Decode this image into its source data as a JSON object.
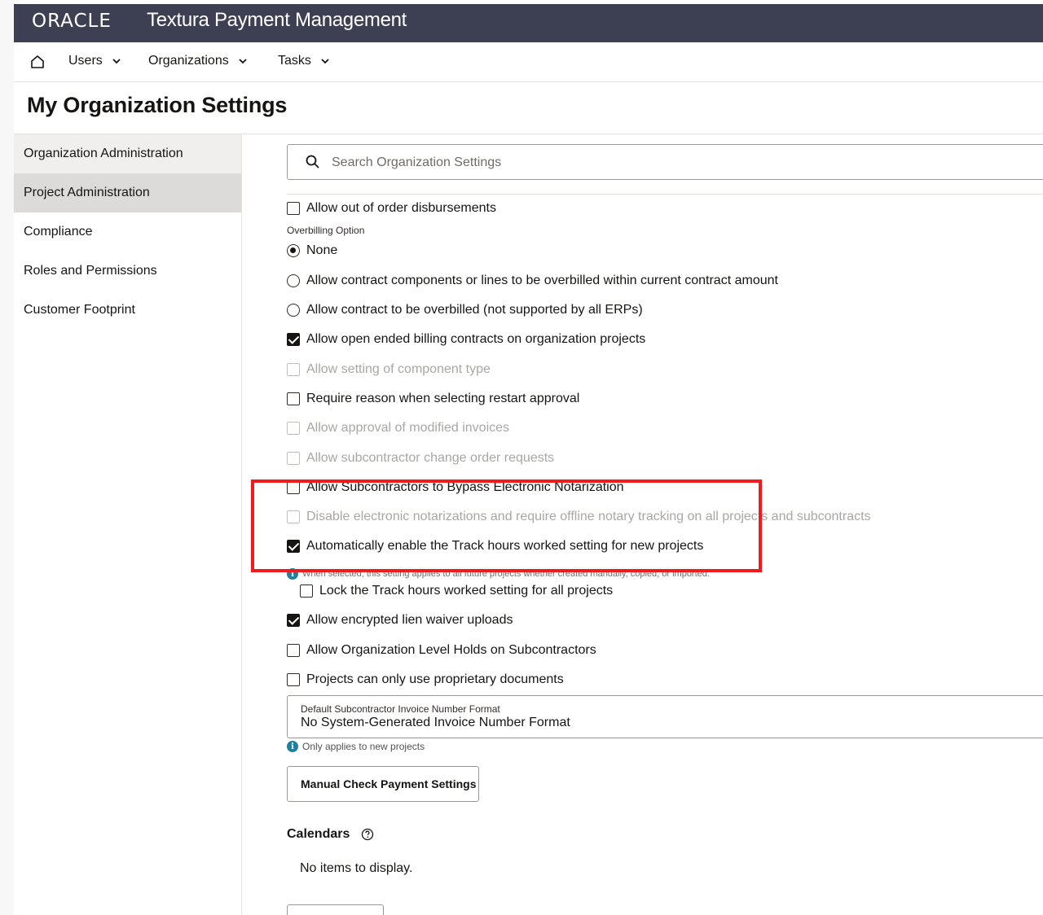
{
  "header": {
    "logo_text": "ORACLE",
    "product_title": "Textura Payment Management"
  },
  "nav": {
    "items": [
      {
        "label": "Users"
      },
      {
        "label": "Organizations"
      },
      {
        "label": "Tasks"
      }
    ]
  },
  "page": {
    "title": "My Organization Settings"
  },
  "sidebar": {
    "items": [
      {
        "label": "Organization Administration"
      },
      {
        "label": "Project Administration"
      },
      {
        "label": "Compliance"
      },
      {
        "label": "Roles and Permissions"
      },
      {
        "label": "Customer Footprint"
      }
    ]
  },
  "search": {
    "placeholder": "Search Organization Settings"
  },
  "settings": {
    "out_of_order": {
      "label": "Allow out of order disbursements",
      "checked": false
    },
    "overbilling_label": "Overbilling Option",
    "overbilling_options": [
      {
        "label": "None",
        "selected": true
      },
      {
        "label": "Allow contract components or lines to be overbilled within current contract amount",
        "selected": false
      },
      {
        "label": "Allow contract to be overbilled (not supported by all ERPs)",
        "selected": false
      }
    ],
    "open_ended": {
      "label": "Allow open ended billing contracts on organization projects",
      "checked": true
    },
    "component_type": {
      "label": "Allow setting of component type",
      "checked": false,
      "disabled": true
    },
    "restart_reason": {
      "label": "Require reason when selecting restart approval",
      "checked": false
    },
    "modified_invoices": {
      "label": "Allow approval of modified invoices",
      "checked": false,
      "disabled": true
    },
    "sub_change_orders": {
      "label": "Allow subcontractor change order requests",
      "checked": false,
      "disabled": true
    },
    "bypass_notarization": {
      "label": "Allow Subcontractors to Bypass Electronic Notarization",
      "checked": false
    },
    "disable_notarizations": {
      "label": "Disable electronic notarizations and require offline notary tracking on all projects and subcontracts",
      "checked": false,
      "disabled": true
    },
    "track_hours": {
      "label": "Automatically enable the Track hours worked setting for new projects",
      "checked": true
    },
    "track_hours_help": "When selected, this setting applies to all future projects whether created manually, copied, or imported.",
    "lock_track_hours": {
      "label": "Lock the Track hours worked setting for all projects",
      "checked": false
    },
    "encrypted_lien": {
      "label": "Allow encrypted lien waiver uploads",
      "checked": true
    },
    "org_holds": {
      "label": "Allow Organization Level Holds on Subcontractors",
      "checked": false
    },
    "proprietary_docs": {
      "label": "Projects can only use proprietary documents",
      "checked": false
    }
  },
  "invoice_format": {
    "label": "Default Subcontractor Invoice Number Format",
    "value": "No System-Generated Invoice Number Format",
    "help": "Only applies to new projects"
  },
  "manual_check_button": "Manual Check Payment Settings",
  "calendars": {
    "title": "Calendars",
    "empty": "No items to display."
  },
  "colors": {
    "header_bg": "#3d4052",
    "highlight": "#ee1c1c",
    "info": "#227e9e"
  }
}
